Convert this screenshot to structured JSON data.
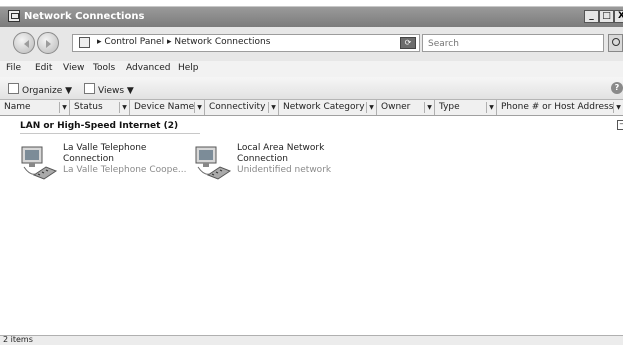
{
  "window": {
    "title": "Network Connections",
    "buttons": {
      "minimize": "_",
      "maximize": "□",
      "close": "X"
    }
  },
  "address": {
    "breadcrumb": [
      "Control Panel",
      "Network Connections"
    ],
    "separator": "▸",
    "dropdown_arrow": "▼",
    "search_placeholder": "Search"
  },
  "menu": [
    "File",
    "Edit",
    "View",
    "Tools",
    "Advanced",
    "Help"
  ],
  "toolbar": {
    "organize": "Organize ▼",
    "views": "Views ▼",
    "help": "?"
  },
  "columns": [
    "Name",
    "Status",
    "Device Name",
    "Connectivity",
    "Network Category",
    "Owner",
    "Type",
    "Phone # or Host Address"
  ],
  "group": {
    "title": "LAN or High-Speed Internet (2)",
    "collapse": "−"
  },
  "connections": [
    {
      "name_line1": "La Valle Telephone",
      "name_line2": "Connection",
      "status": "La Valle Telephone Coope..."
    },
    {
      "name_line1": "Local Area Network",
      "name_line2": "Connection",
      "status": "Unidentified network"
    }
  ],
  "status_bar": "2 items",
  "icons": [
    "network-connections-icon",
    "back-arrow-icon",
    "forward-arrow-icon",
    "control-panel-icon",
    "refresh-icon",
    "search-icon",
    "organize-icon",
    "views-icon",
    "help-icon",
    "network-adapter-icon"
  ]
}
